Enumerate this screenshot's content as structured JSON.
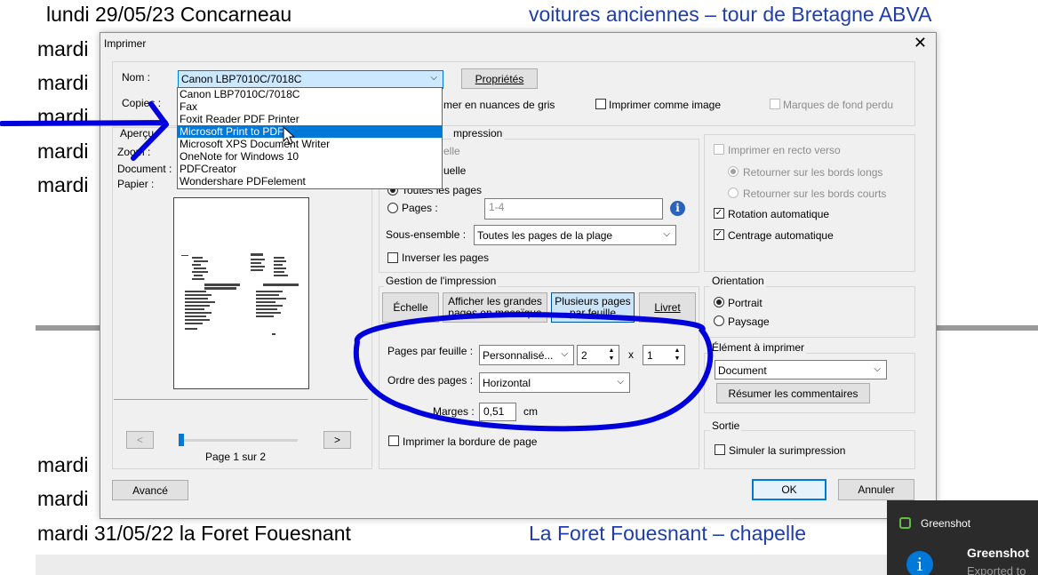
{
  "background": {
    "row_top_left": "lundi 29/05/23 Concarneau",
    "row_top_right": "voitures anciennes – tour de Bretagne ABVA",
    "mardi": "mardi",
    "row_bottom_left": "mardi 31/05/22 la Foret Fouesnant",
    "row_bottom_right": "La Foret Fouesnant – chapelle"
  },
  "dialog": {
    "title": "Imprimer",
    "close": "✕",
    "printer": {
      "name_label": "Nom :",
      "selected": "Canon LBP7010C/7018C",
      "properties_button": "Propriétés",
      "copies_label": "Copies :",
      "apercu_label": "Aperçu",
      "zoom_label": "Zoom :",
      "document_label": "Document :",
      "paper_label": "Papier :",
      "options": [
        "Canon LBP7010C/7018C",
        "Fax",
        "Foxit Reader PDF Printer",
        "Microsoft Print to PDF",
        "Microsoft XPS Document Writer",
        "OneNote for Windows 10",
        "PDFCreator",
        "Wondershare PDFelement"
      ],
      "highlighted_index": 3
    },
    "gray_label": "Imprimer en nuances de gris",
    "gray_partial": "mer en nuances de gris",
    "image_label": "Imprimer comme image",
    "bleed_label": "Marques de fond perdu",
    "pages": {
      "legend": "mpression",
      "vue_partial": "elle",
      "page_partial": "uelle",
      "all_pages": "Toutes les pages",
      "pages_label": "Pages :",
      "pages_value": "1-4",
      "subset_label": "Sous-ensemble :",
      "subset_value": "Toutes les pages de la plage",
      "reverse_label": "Inverser les pages"
    },
    "sizing": {
      "legend": "Gestion de l'impression",
      "scale_button": "Échelle",
      "poster_button_1": "Afficher les grandes",
      "poster_button_2": "pages en mosaïque",
      "multiple_button_1": "Plusieurs pages",
      "multiple_button_2": "par feuille",
      "booklet_button": "Livret",
      "pps_label": "Pages par feuille :",
      "pps_value": "Personnalisé...",
      "cols_value": "2",
      "times": "x",
      "rows_value": "1",
      "order_label": "Ordre des pages :",
      "order_value": "Horizontal",
      "margins_label": "Marges :",
      "margins_value": "0,51",
      "margins_unit": "cm",
      "border_label": "Imprimer la bordure de page"
    },
    "duplex": {
      "label": "Imprimer en recto verso",
      "long_edge": "Retourner sur les bords longs",
      "short_edge": "Retourner sur les bords courts",
      "auto_rotate": "Rotation automatique",
      "auto_center": "Centrage automatique"
    },
    "orientation": {
      "legend": "Orientation",
      "portrait": "Portrait",
      "landscape": "Paysage"
    },
    "element": {
      "legend": "Élément à imprimer",
      "value": "Document",
      "summarize_button": "Résumer les commentaires"
    },
    "output": {
      "legend": "Sortie",
      "simulate_label": "Simuler la surimpression"
    },
    "navigation": {
      "prev": "<",
      "next": ">",
      "page_info": "Page 1 sur 2"
    },
    "advanced_button": "Avancé",
    "ok_button": "OK",
    "cancel_button": "Annuler"
  },
  "toast": {
    "app": "Greenshot",
    "title": "Greenshot",
    "message": "Exported to"
  },
  "colors": {
    "annotation": "#0000dd",
    "selection": "#0078d7",
    "link_blue": "#1f3ea8"
  }
}
